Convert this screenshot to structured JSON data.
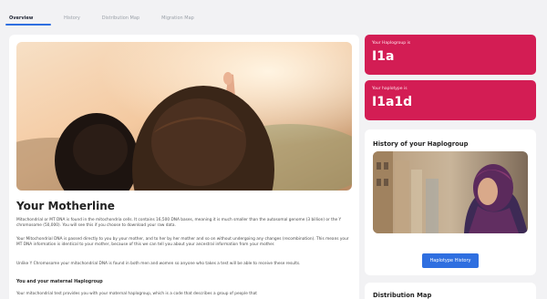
{
  "tabs": [
    {
      "label": "Overview",
      "active": true
    },
    {
      "label": "History",
      "active": false
    },
    {
      "label": "Distribution Map",
      "active": false
    },
    {
      "label": "Migration Map",
      "active": false
    }
  ],
  "main": {
    "title": "Your Motherline",
    "paragraph_1": "Mitochondrial or MT DNA is found in the mitochondria cells. It contains 16,500 DNA bases, meaning it is much smaller than the autosomal genome (3 billion) or the Y chromosome (50,000). You will see this if you choose to download your raw data.",
    "paragraph_2": "Your Mitochondrial DNA is passed directly to you by your mother, and to her by her mother and so on without undergoing any changes (recombination). This means your MT DNA information is identical to your mother, because of this we can tell you about your ancestral information from your mother.",
    "paragraph_3": "Unlike Y Chromosome your mitochondrial DNA is found in both men and women so anyone who takes a test will be able to receive these results.",
    "subheading": "You and your maternal Haplogroup",
    "paragraph_4": "Your mitochondrial test provides you with your maternal haplogroup, which is a code that describes a group of people that"
  },
  "haplogroup": {
    "label": "Your Haplogroup is",
    "value": "I1a"
  },
  "haplotype": {
    "label": "Your haplotype is",
    "value": "I1a1d"
  },
  "history_card": {
    "title": "History of your Haplogroup",
    "button_label": "Haplotype History"
  },
  "distribution_card": {
    "title": "Distribution Map"
  },
  "colors": {
    "accent": "#2f6fe0",
    "badge": "#d31d54"
  }
}
